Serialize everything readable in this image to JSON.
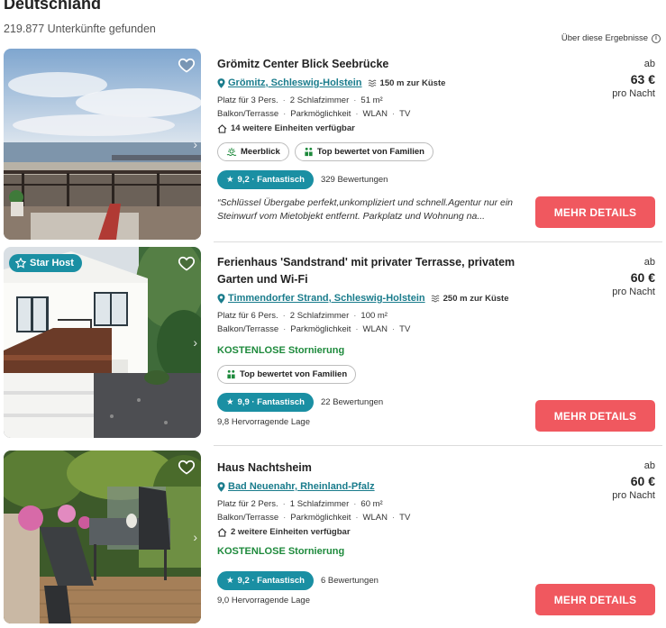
{
  "header": {
    "title": "Deutschland",
    "count": "219.877 Unterkünfte gefunden",
    "about": "Über diese Ergebnisse"
  },
  "listings": [
    {
      "title": "Grömitz Center Blick Seebrücke",
      "location": "Grömitz, Schleswig-Holstein",
      "coast": "150 m zur Küste",
      "specs": [
        "Platz für 3 Pers.",
        "2 Schlafzimmer",
        "51 m²"
      ],
      "amenities": [
        "Balkon/Terrasse",
        "Parkmöglichkeit",
        "WLAN",
        "TV"
      ],
      "units": "14 weitere Einheiten verfügbar",
      "badges": [
        "Meerblick",
        "Top bewertet von Familien"
      ],
      "rating": "9,2 · Fantastisch",
      "reviews": "329 Bewertungen",
      "review_text": "“Schlüssel Übergabe perfekt,unkompliziert und schnell.Agentur nur ein Steinwurf vom Mietobjekt entfernt. Parkplatz und Wohnung na...",
      "price_prefix": "ab",
      "price": "63 €",
      "per_night": "pro Nacht",
      "button": "MEHR DETAILS"
    },
    {
      "star_host": "Star Host",
      "title": "Ferienhaus 'Sandstrand' mit privater Terrasse, privatem Garten und Wi-Fi",
      "location": "Timmendorfer Strand, Schleswig-Holstein",
      "coast": "250 m zur Küste",
      "specs": [
        "Platz für 6 Pers.",
        "2 Schlafzimmer",
        "100 m²"
      ],
      "amenities": [
        "Balkon/Terrasse",
        "Parkmöglichkeit",
        "WLAN",
        "TV"
      ],
      "free_cancel": "KOSTENLOSE Stornierung",
      "badges": [
        "Top bewertet von Familien"
      ],
      "rating": "9,9 · Fantastisch",
      "reviews": "22 Bewertungen",
      "rating_sub": "9,8 Hervorragende Lage",
      "price_prefix": "ab",
      "price": "60 €",
      "per_night": "pro Nacht",
      "button": "MEHR DETAILS"
    },
    {
      "title": "Haus Nachtsheim",
      "location": "Bad Neuenahr, Rheinland-Pfalz",
      "specs": [
        "Platz für 2 Pers.",
        "1 Schlafzimmer",
        "60 m²"
      ],
      "amenities": [
        "Balkon/Terrasse",
        "Parkmöglichkeit",
        "WLAN",
        "TV"
      ],
      "units": "2 weitere Einheiten verfügbar",
      "free_cancel": "KOSTENLOSE Stornierung",
      "rating": "9,2 · Fantastisch",
      "reviews": "6 Bewertungen",
      "rating_sub": "9,0 Hervorragende Lage",
      "price_prefix": "ab",
      "price": "60 €",
      "per_night": "pro Nacht",
      "button": "MEHR DETAILS"
    }
  ],
  "colors": {
    "accent_teal": "#1a8fa3",
    "link_teal": "#1a7c8c",
    "button_coral": "#f0585f",
    "green": "#1e8a3c"
  }
}
